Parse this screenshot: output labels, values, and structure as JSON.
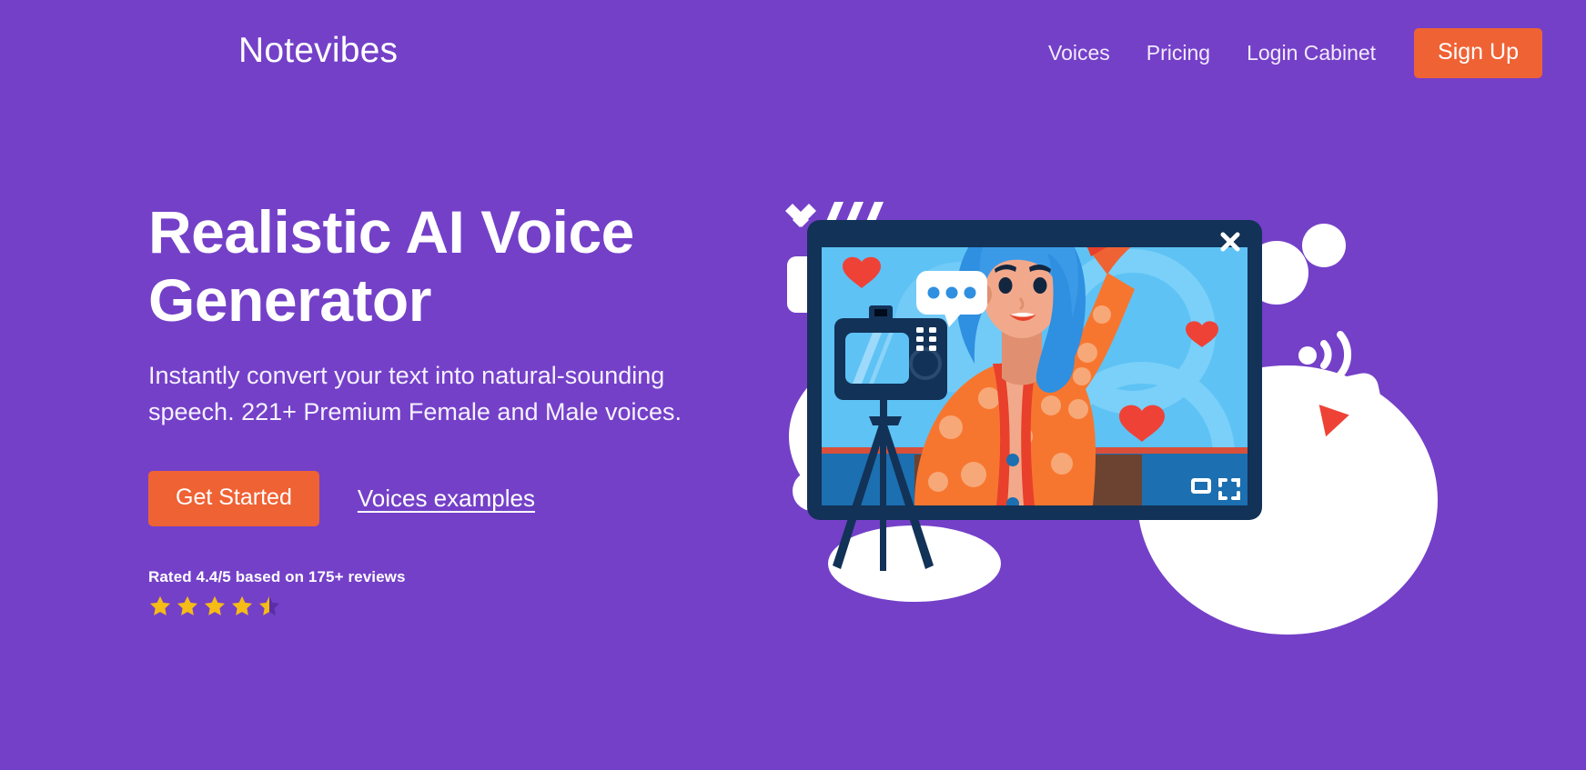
{
  "theme": {
    "background": "#7440c8",
    "accent_orange": "#ef6234",
    "text_white": "#ffffff",
    "star_gold": "#f5bb17",
    "screen_blue": "#5ec2f5",
    "frame_navy": "#123257",
    "heart_red": "#ee4237"
  },
  "header": {
    "brand": "Notevibes",
    "nav": [
      {
        "label": "Voices",
        "name": "nav-link-voices"
      },
      {
        "label": "Pricing",
        "name": "nav-link-pricing"
      },
      {
        "label": "Login Cabinet",
        "name": "nav-link-login-cabinet"
      }
    ],
    "signup_label": "Sign Up"
  },
  "hero": {
    "title": "Realistic AI Voice Generator",
    "subtitle": "Instantly convert your text into natural-sounding speech. 221+ Premium Female and Male voices.",
    "primary_cta": "Get Started",
    "secondary_cta": "Voices examples",
    "rating_text": "Rated 4.4/5 based on 175+ reviews",
    "rating_value": 4.4,
    "rating_max": 5,
    "reviews_count": "175+",
    "stars_full": 4,
    "stars_half": 1
  },
  "illustration": {
    "name": "video-call-illustration",
    "player_close_icon": "×",
    "player_minimize_icon": "minimize-icon",
    "player_fullscreen_icon": "fullscreen-icon",
    "camera_icon": "camera-icon",
    "no_camera_icon": "no-camera-icon",
    "wifi_icon": "wifi-icon",
    "play_badge_icon": "play-icon",
    "chat_bubble_icon": "chat-bubble-icon",
    "heart_icon": "heart-icon",
    "hearts_count": 4
  }
}
